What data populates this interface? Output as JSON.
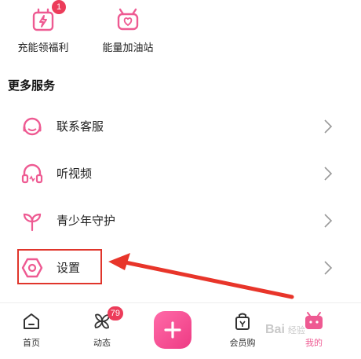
{
  "top_tiles": [
    {
      "label": "充能领福利",
      "icon": "gift-bolt-icon",
      "badge": "1"
    },
    {
      "label": "能量加油站",
      "icon": "tv-heart-icon"
    }
  ],
  "section": {
    "title": "更多服务"
  },
  "services": [
    {
      "label": "联系客服",
      "icon": "headset-service-icon"
    },
    {
      "label": "听视频",
      "icon": "headphones-icon"
    },
    {
      "label": "青少年守护",
      "icon": "sprout-icon"
    },
    {
      "label": "设置",
      "icon": "hexagon-settings-icon"
    }
  ],
  "tabbar": {
    "home": {
      "label": "首页"
    },
    "dynamic": {
      "label": "动态",
      "badge": "79"
    },
    "member": {
      "label": "会员购"
    },
    "mine": {
      "label": "我的"
    }
  },
  "watermark": {
    "text": "Bai",
    "sub": "经验"
  },
  "colors": {
    "accent": "#ee5a92",
    "highlight": "#e0352b",
    "arrow": "#e8352a"
  }
}
